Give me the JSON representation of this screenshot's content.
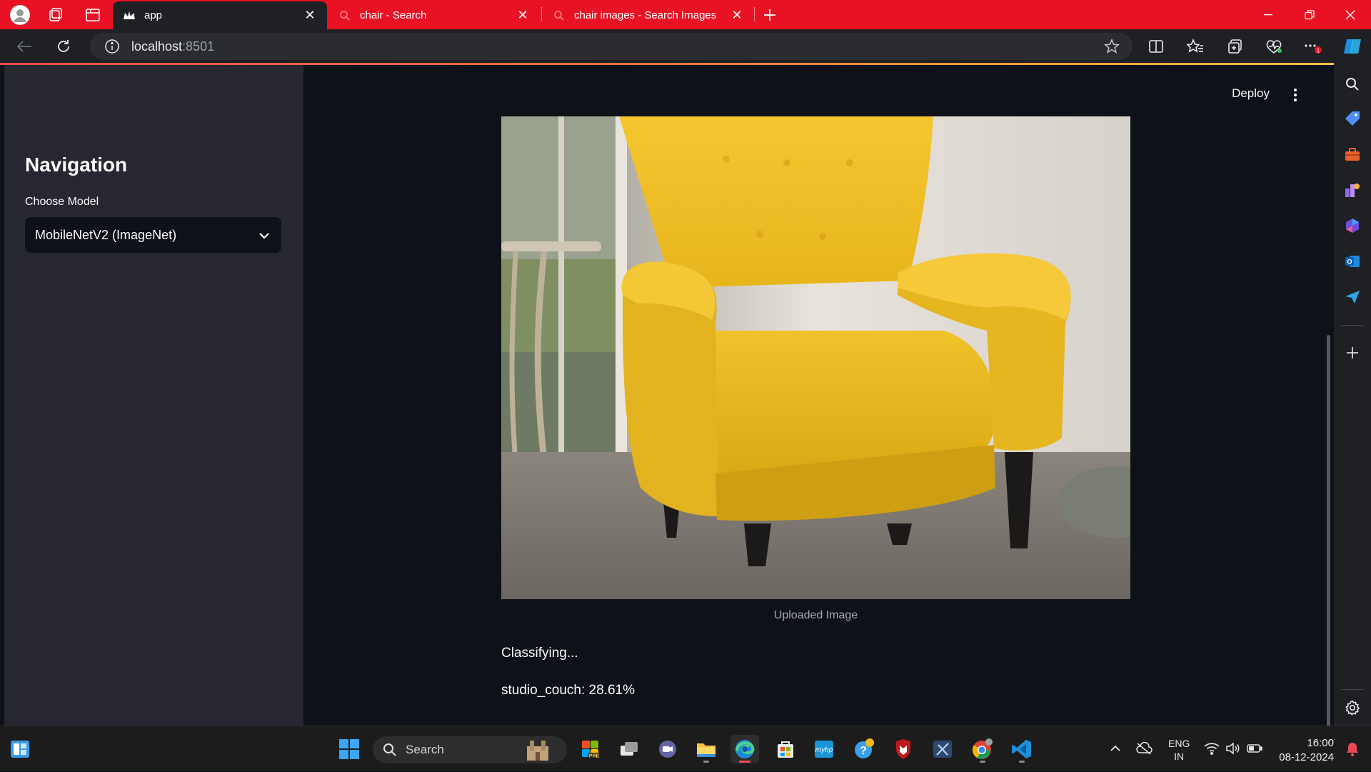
{
  "browser": {
    "tabs": [
      {
        "label": "app",
        "active": true
      },
      {
        "label": "chair - Search",
        "active": false
      },
      {
        "label": "chair images - Search Images",
        "active": false
      }
    ],
    "address": {
      "host": "localhost",
      "port": ":8501"
    },
    "accent_color": "#e81224"
  },
  "app": {
    "sidebar": {
      "title": "Navigation",
      "model_label": "Choose Model",
      "model_selected": "MobileNetV2 (ImageNet)"
    },
    "header": {
      "deploy_label": "Deploy"
    },
    "main": {
      "image_caption": "Uploaded Image",
      "status_text": "Classifying...",
      "prediction": "studio_couch: 28.61%"
    },
    "colors": {
      "background": "#0e1117",
      "sidebar": "#262730",
      "primary": "#ff4b4b"
    }
  },
  "taskbar": {
    "search_placeholder": "Search",
    "language": {
      "code": "ENG",
      "region": "IN"
    },
    "clock": {
      "time": "16:00",
      "date": "08-12-2024"
    }
  }
}
